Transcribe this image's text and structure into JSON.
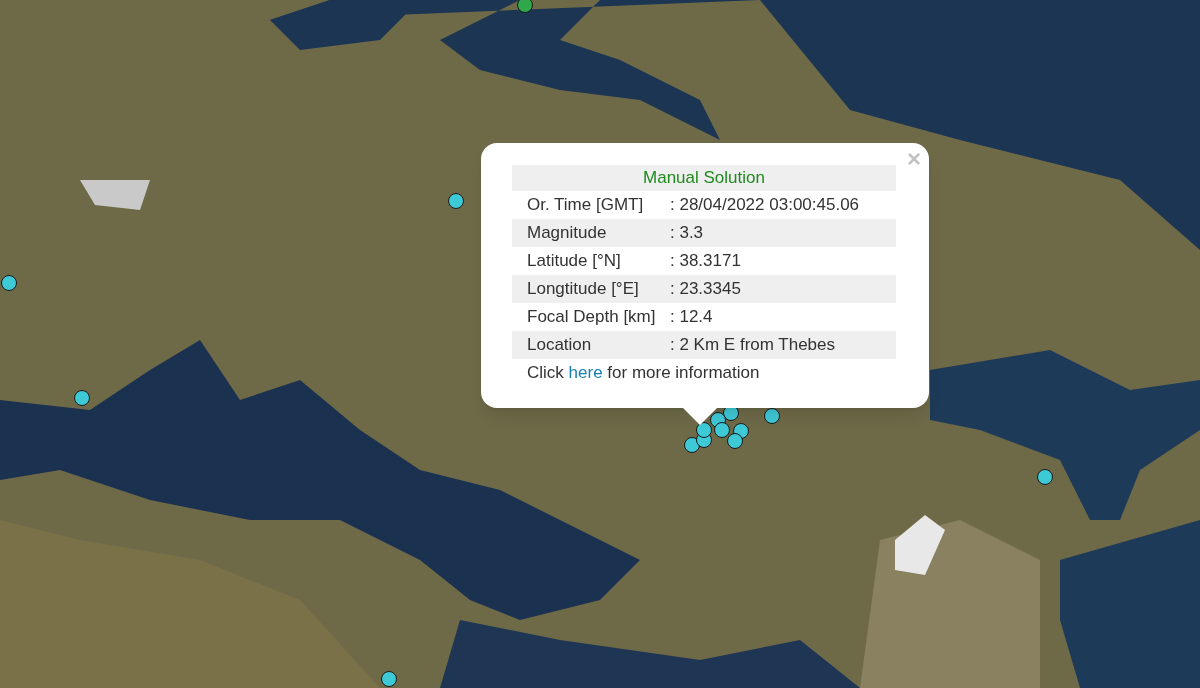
{
  "map": {
    "markers": [
      {
        "color": "#2ea84a"
      },
      {
        "color": "#3ec9d6"
      },
      {
        "color": "#3ec9d6"
      },
      {
        "color": "#3ec9d6"
      },
      {
        "color": "#3ec9d6"
      },
      {
        "color": "#3ec9d6"
      },
      {
        "color": "#3ec9d6"
      },
      {
        "color": "#3ec9d6"
      },
      {
        "color": "#3ec9d6"
      },
      {
        "color": "#3ec9d6"
      },
      {
        "color": "#3ec9d6"
      },
      {
        "color": "#3ec9d6"
      },
      {
        "color": "#3ec9d6"
      },
      {
        "color": "#3ec9d6"
      },
      {
        "color": "#3ec9d6"
      }
    ]
  },
  "popup": {
    "close": "×",
    "title": "Manual Solution",
    "rows": [
      {
        "label": "Or. Time [GMT]",
        "value": ": 28/04/2022 03:00:45.06"
      },
      {
        "label": "Magnitude",
        "value": ": 3.3"
      },
      {
        "label": "Latitude [°N]",
        "value": ": 38.3171"
      },
      {
        "label": "Longtitude [°E]",
        "value": ": 23.3345"
      },
      {
        "label": "Focal Depth [km]",
        "value": ": 12.4"
      },
      {
        "label": "Location",
        "value": ": 2 Km E from Thebes"
      }
    ],
    "footer": {
      "before": "Click",
      "link": "here",
      "after": "for more information"
    }
  }
}
